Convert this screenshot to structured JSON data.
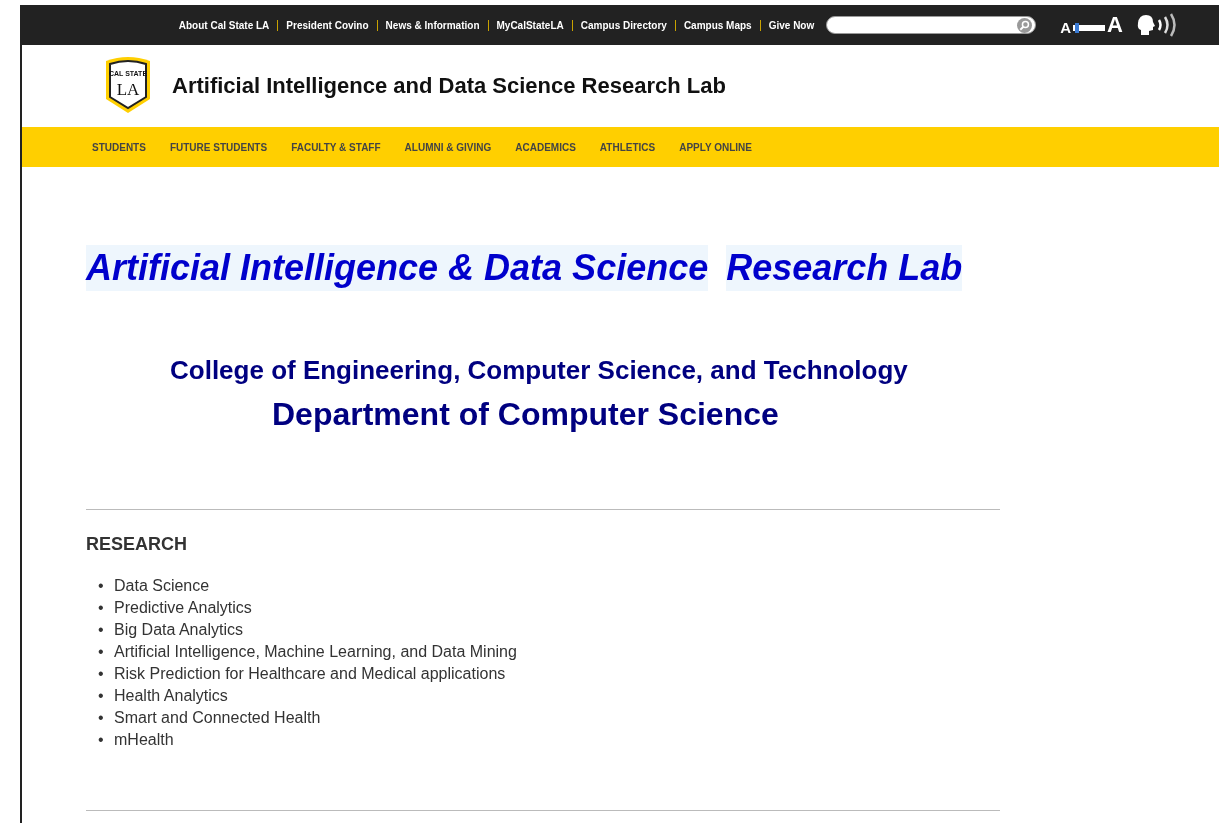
{
  "utility_bar": {
    "links": [
      "About Cal State LA",
      "President Covino",
      "News & Information",
      "MyCalStateLA",
      "Campus Directory",
      "Campus Maps",
      "Give Now"
    ],
    "text_size": {
      "small_label": "A",
      "large_label": "A",
      "level": 0.05
    }
  },
  "header": {
    "logo": {
      "top_text": "CAL STATE",
      "main_text": "LA"
    },
    "site_title": "Artificial Intelligence and Data Science Research Lab"
  },
  "main_nav": [
    "STUDENTS",
    "FUTURE STUDENTS",
    "FACULTY & STAFF",
    "ALUMNI & GIVING",
    "ACADEMICS",
    "ATHLETICS",
    "APPLY ONLINE"
  ],
  "content": {
    "title_parts": [
      "Artificial Intelligence & Data Science",
      "Research Lab"
    ],
    "college": "College of Engineering, Computer Science, and Technology",
    "department": "Department of Computer Science",
    "section_heading": "RESEARCH",
    "bullet": "•",
    "research_items": [
      "Data Science",
      "Predictive Analytics",
      "Big Data Analytics",
      "Artificial Intelligence, Machine Learning, and Data Mining",
      "Risk Prediction for Healthcare and Medical applications",
      "Health Analytics",
      "Smart and Connected Health",
      "mHealth"
    ]
  }
}
